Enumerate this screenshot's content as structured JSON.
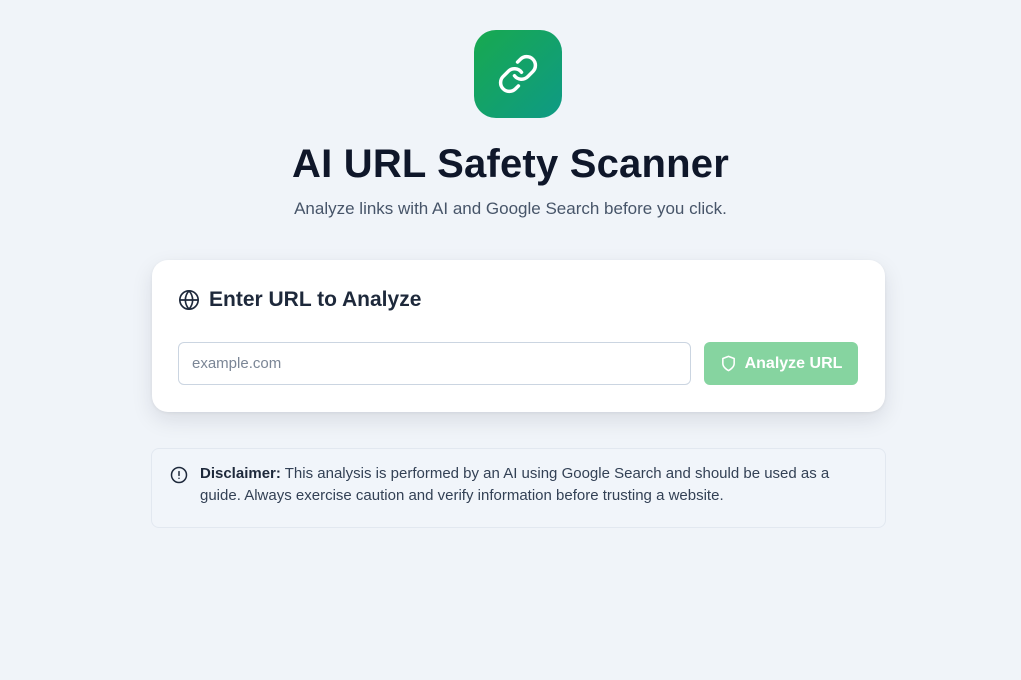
{
  "app": {
    "title": "AI URL Safety Scanner",
    "subtitle": "Analyze links with AI and Google Search before you click."
  },
  "logo": {
    "icon": "link-icon",
    "gradient_start": "#18a94f",
    "gradient_end": "#0e9a85"
  },
  "card": {
    "title": "Enter URL to Analyze",
    "title_icon": "globe-icon",
    "input": {
      "value": "",
      "placeholder": "example.com"
    },
    "button": {
      "label": "Analyze URL",
      "icon": "shield-icon",
      "color": "#86d4a0"
    }
  },
  "disclaimer": {
    "icon": "info-circle-icon",
    "label": "Disclaimer:",
    "text": " This analysis is performed by an AI using Google Search and should be used as a guide. Always exercise caution and verify information before trusting a website."
  }
}
